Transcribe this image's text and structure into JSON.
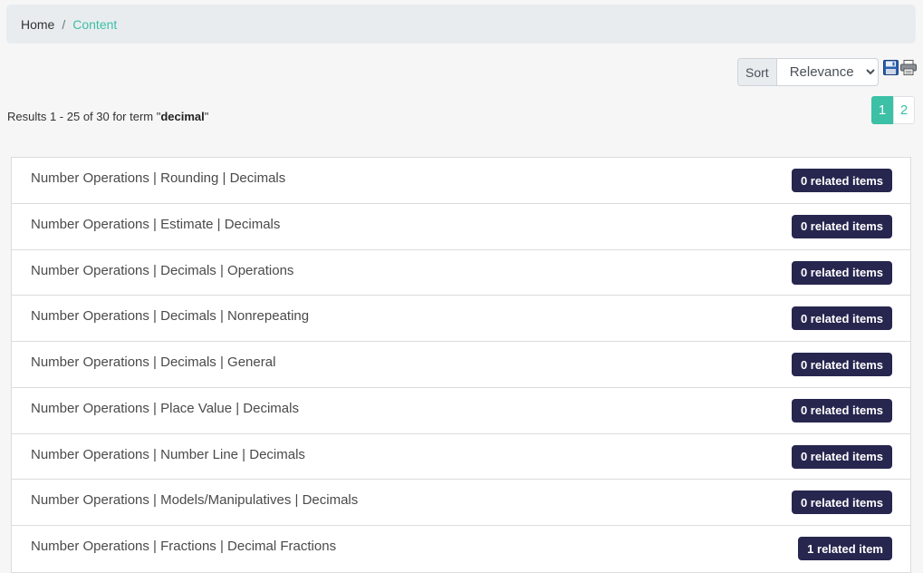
{
  "breadcrumb": {
    "home": "Home",
    "separator": "/",
    "current": "Content"
  },
  "toolbar": {
    "sort_label": "Sort",
    "sort_selected": "Relevance",
    "save_icon": "save-icon",
    "print_icon": "print-icon"
  },
  "results": {
    "prefix": "Results 1 - 25 of 30 for term \"",
    "term": "decimal",
    "suffix": "\""
  },
  "pagination": {
    "pages": [
      "1",
      "2"
    ],
    "current": "1"
  },
  "items": [
    {
      "title": "Number Operations | Rounding | Decimals",
      "badge": "0 related items"
    },
    {
      "title": "Number Operations | Estimate | Decimals",
      "badge": "0 related items"
    },
    {
      "title": "Number Operations | Decimals | Operations",
      "badge": "0 related items"
    },
    {
      "title": "Number Operations | Decimals | Nonrepeating",
      "badge": "0 related items"
    },
    {
      "title": "Number Operations | Decimals | General",
      "badge": "0 related items"
    },
    {
      "title": "Number Operations | Place Value | Decimals",
      "badge": "0 related items"
    },
    {
      "title": "Number Operations | Number Line | Decimals",
      "badge": "0 related items"
    },
    {
      "title": "Number Operations | Models/Manipulatives | Decimals",
      "badge": "0 related items"
    },
    {
      "title": "Number Operations | Fractions | Decimal Fractions",
      "badge": "1 related item"
    }
  ],
  "colors": {
    "accent": "#3cc0a6",
    "badge_bg": "#27264f",
    "breadcrumb_bg": "#e9ecef"
  }
}
